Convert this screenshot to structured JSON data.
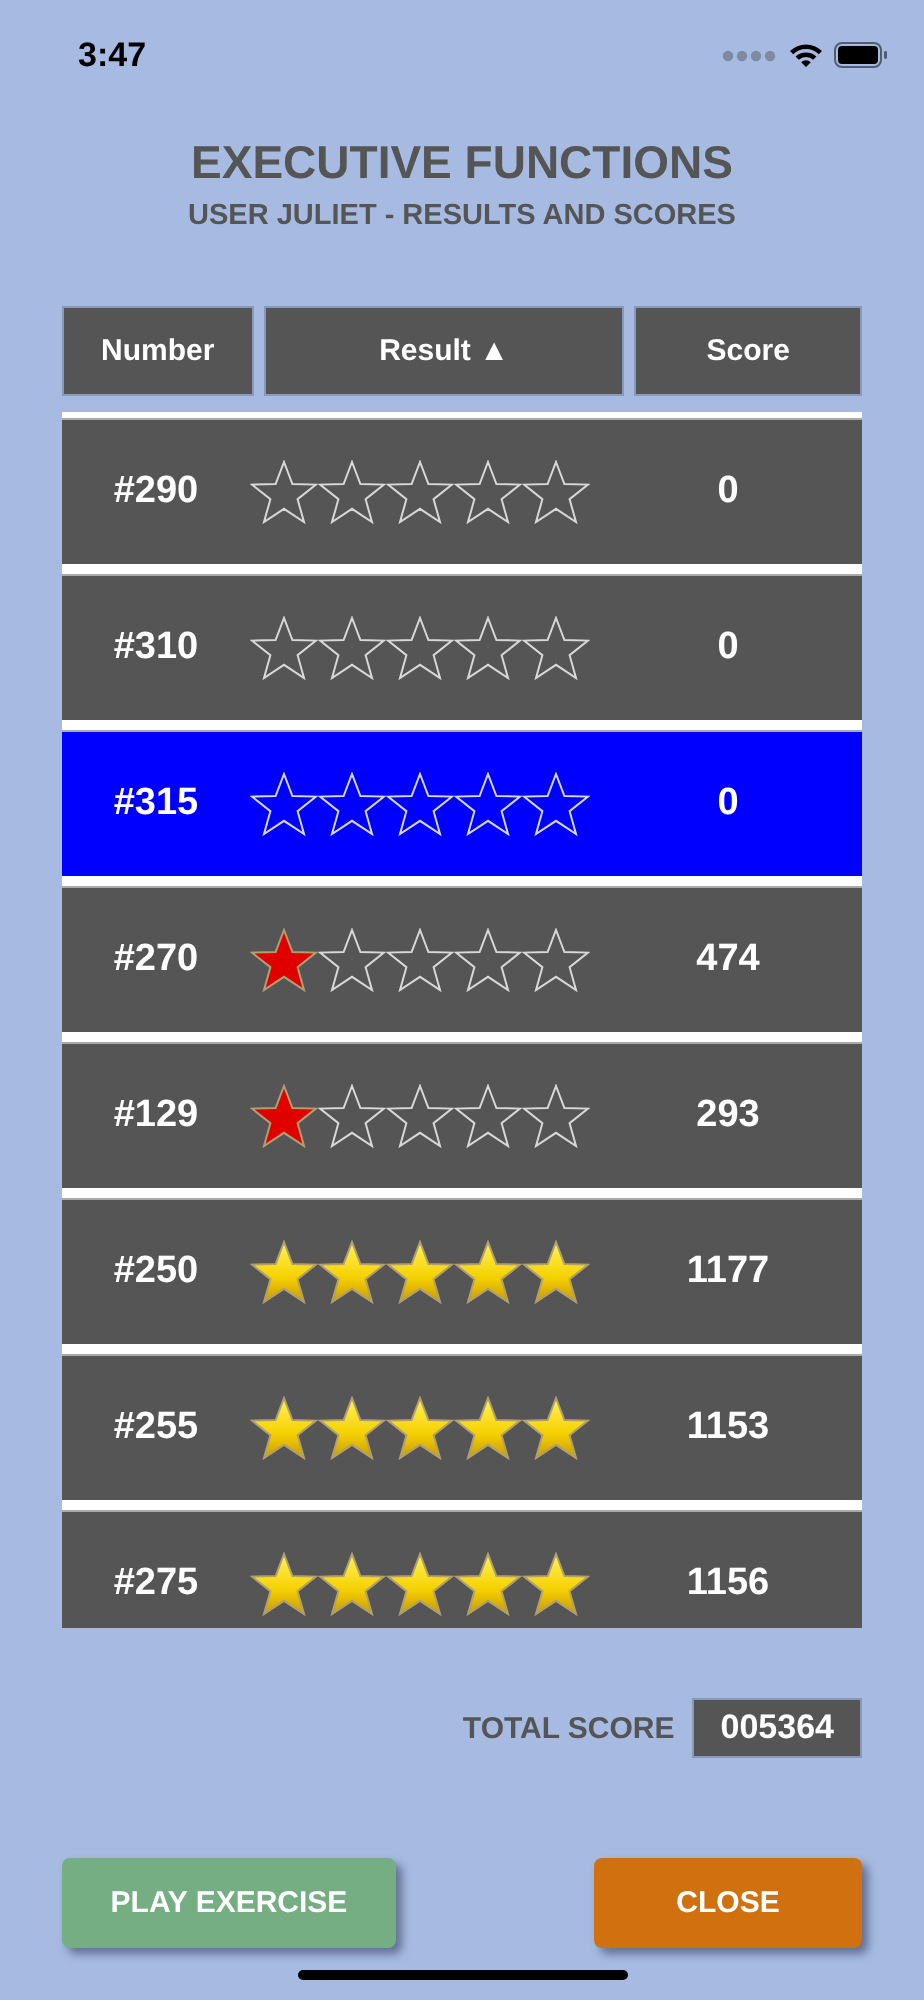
{
  "status_bar": {
    "time": "3:47"
  },
  "title": "EXECUTIVE FUNCTIONS",
  "subtitle": "USER JULIET - RESULTS AND SCORES",
  "table": {
    "columns": [
      {
        "label": "Number"
      },
      {
        "label": "Result ▲"
      },
      {
        "label": "Score"
      }
    ],
    "rows": [
      {
        "number": "#290",
        "stars": 0,
        "score": "0",
        "selected": false
      },
      {
        "number": "#310",
        "stars": 0,
        "score": "0",
        "selected": false
      },
      {
        "number": "#315",
        "stars": 0,
        "score": "0",
        "selected": true
      },
      {
        "number": "#270",
        "stars": 1,
        "score": "474",
        "selected": false
      },
      {
        "number": "#129",
        "stars": 1,
        "score": "293",
        "selected": false
      },
      {
        "number": "#250",
        "stars": 5,
        "score": "1177",
        "selected": false
      },
      {
        "number": "#255",
        "stars": 5,
        "score": "1153",
        "selected": false
      },
      {
        "number": "#275",
        "stars": 5,
        "score": "1156",
        "selected": false
      }
    ]
  },
  "total_score": {
    "label": "TOTAL SCORE",
    "value": "005364"
  },
  "buttons": [
    {
      "kind": "play",
      "label": "PLAY EXERCISE"
    },
    {
      "kind": "close",
      "label": "CLOSE"
    }
  ]
}
